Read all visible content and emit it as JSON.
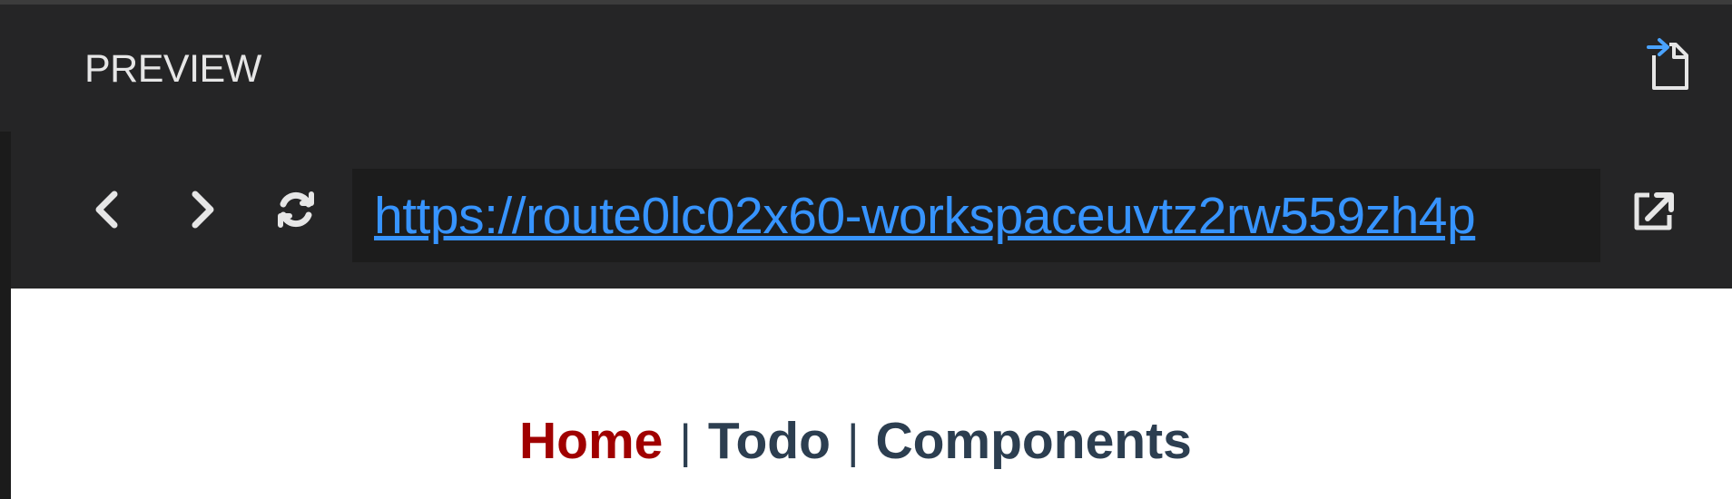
{
  "panel": {
    "title": "PREVIEW"
  },
  "icons": {
    "open_preview": "open-preview-icon",
    "back": "chevron-left-icon",
    "forward": "chevron-right-icon",
    "refresh": "refresh-icon",
    "external": "external-link-icon"
  },
  "toolbar": {
    "url": "https://route0lc02x60-workspaceuvtz2rw559zh4p"
  },
  "site_nav": {
    "items": [
      {
        "label": "Home",
        "active": true
      },
      {
        "label": "Todo",
        "active": false
      },
      {
        "label": "Components",
        "active": false
      }
    ],
    "separator": "|"
  },
  "colors": {
    "panel_bg": "#252526",
    "url_bg": "#1c1c1c",
    "link": "#3794ff",
    "accent_blue": "#4aa3ff",
    "active_nav": "#a00000",
    "nav_text": "#2c3e50"
  }
}
